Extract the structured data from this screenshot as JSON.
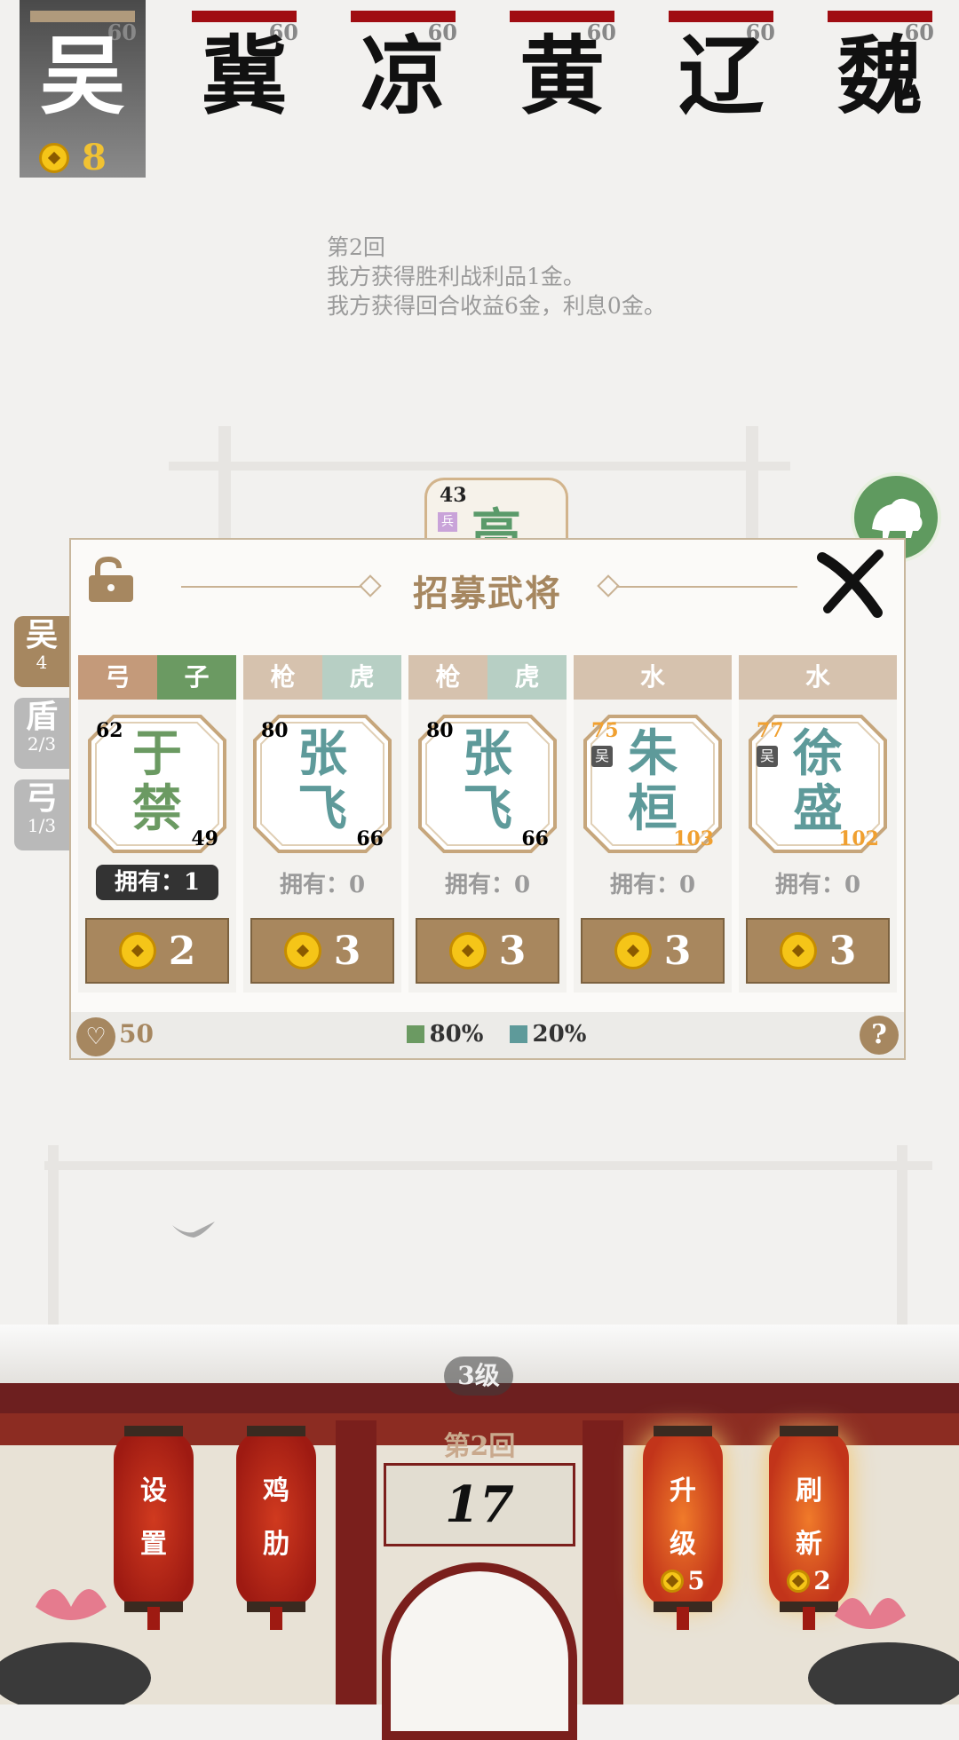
{
  "factions": [
    {
      "glyph": "吴",
      "hp": "60",
      "gold": "8",
      "player": true
    },
    {
      "glyph": "冀",
      "hp": "60"
    },
    {
      "glyph": "凉",
      "hp": "60"
    },
    {
      "glyph": "黄",
      "hp": "60"
    },
    {
      "glyph": "辽",
      "hp": "60"
    },
    {
      "glyph": "魏",
      "hp": "60"
    }
  ],
  "log": [
    "第2回",
    "我方获得胜利战利品1金。",
    "我方获得回合收益6金，利息0金。"
  ],
  "enemy_unit": {
    "attack": "43",
    "badge": "兵",
    "glyph": "高"
  },
  "side_tabs": [
    {
      "t1": "吴",
      "t2": "4"
    },
    {
      "t1": "盾",
      "t2": "2/3"
    },
    {
      "t1": "弓",
      "t2": "1/3"
    }
  ],
  "modal": {
    "title": "招募武将",
    "cards": [
      {
        "tags": [
          "弓",
          "子"
        ],
        "name1": "于",
        "name2": "禁",
        "atk": "62",
        "hp": "49",
        "own": "拥有：1",
        "owned": true,
        "cost": "2",
        "color": "#6b9a62"
      },
      {
        "tags": [
          "枪",
          "虎"
        ],
        "name1": "张",
        "name2": "飞",
        "atk": "80",
        "hp": "66",
        "own": "拥有：0",
        "owned": false,
        "cost": "3",
        "color": "#5e9a9a"
      },
      {
        "tags": [
          "枪",
          "虎"
        ],
        "name1": "张",
        "name2": "飞",
        "atk": "80",
        "hp": "66",
        "own": "拥有：0",
        "owned": false,
        "cost": "3",
        "color": "#5e9a9a"
      },
      {
        "tags": [
          "水"
        ],
        "name1": "朱",
        "name2": "桓",
        "atk": "75",
        "hp": "103",
        "faction": "吴",
        "own": "拥有：0",
        "owned": false,
        "cost": "3",
        "color": "#5e9a9a"
      },
      {
        "tags": [
          "水"
        ],
        "name1": "徐",
        "name2": "盛",
        "atk": "77",
        "hp": "102",
        "faction": "吴",
        "own": "拥有：0",
        "owned": false,
        "cost": "3",
        "color": "#5e9a9a"
      }
    ],
    "footer": {
      "hearts": "50",
      "legend": [
        {
          "label": "80%",
          "color": "#6b9a62"
        },
        {
          "label": "20%",
          "color": "#5e9a9a"
        }
      ],
      "help": "?"
    }
  },
  "palace": {
    "level": "3级",
    "round": "第2回",
    "timer": "17",
    "lanterns": [
      {
        "l1": "设",
        "l2": "置"
      },
      {
        "l1": "鸡",
        "l2": "肋"
      },
      {
        "l1": "升",
        "l2": "级",
        "cost": "5"
      },
      {
        "l1": "刷",
        "l2": "新",
        "cost": "2"
      }
    ]
  }
}
